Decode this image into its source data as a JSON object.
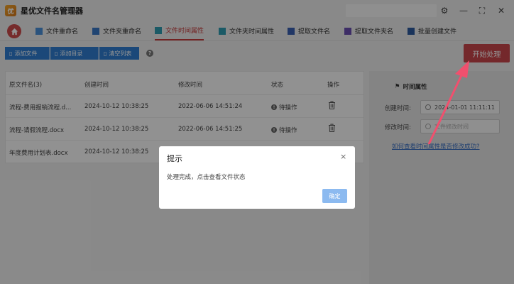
{
  "app": {
    "title": "星优文件名管理器",
    "logo_char": "优"
  },
  "window": {
    "settings_glyph": "⚙",
    "minimize_glyph": "—",
    "maximize_glyph": "⛶",
    "close_glyph": "✕"
  },
  "tabs": [
    {
      "label": "文件重命名",
      "active": false
    },
    {
      "label": "文件夹重命名",
      "active": false
    },
    {
      "label": "文件时间属性",
      "active": true
    },
    {
      "label": "文件夹时间属性",
      "active": false
    },
    {
      "label": "提取文件名",
      "active": false
    },
    {
      "label": "提取文件夹名",
      "active": false
    },
    {
      "label": "批量创建文件",
      "active": false
    }
  ],
  "toolbar": {
    "add_file": "添加文件",
    "add_dir": "添加目录",
    "clear_list": "清空列表",
    "help_glyph": "?",
    "start": "开始处理"
  },
  "table": {
    "headers": [
      "原文件名(3)",
      "创建时间",
      "修改时间",
      "状态",
      "操作"
    ],
    "rows": [
      {
        "name": "流程-费用报销流程.d...",
        "created": "2024-10-12 10:38:25",
        "modified": "2022-06-06 14:51:24",
        "status": "待操作"
      },
      {
        "name": "流程-请假流程.docx",
        "created": "2024-10-12 10:38:25",
        "modified": "2022-06-06 14:51:25",
        "status": "待操作"
      },
      {
        "name": "年度费用计划表.docx",
        "created": "2024-10-12 10:38:25",
        "modified": "",
        "status": ""
      }
    ]
  },
  "panel": {
    "title": "时间属性",
    "created_label": "创建时间:",
    "created_value": "2024-01-01 11:11:11",
    "modified_label": "修改时间:",
    "modified_placeholder": "文件修改时间",
    "help_link": "如何查看时间属性是否修改成功?"
  },
  "dialog": {
    "title": "提示",
    "close_glyph": "×",
    "message": "处理完成，点击查看文件状态",
    "ok": "确定"
  },
  "colors": {
    "accent": "#c43b3b",
    "primary": "#2f7dd1",
    "start": "#c9454a",
    "annotation_arrow": "#f0506e"
  }
}
